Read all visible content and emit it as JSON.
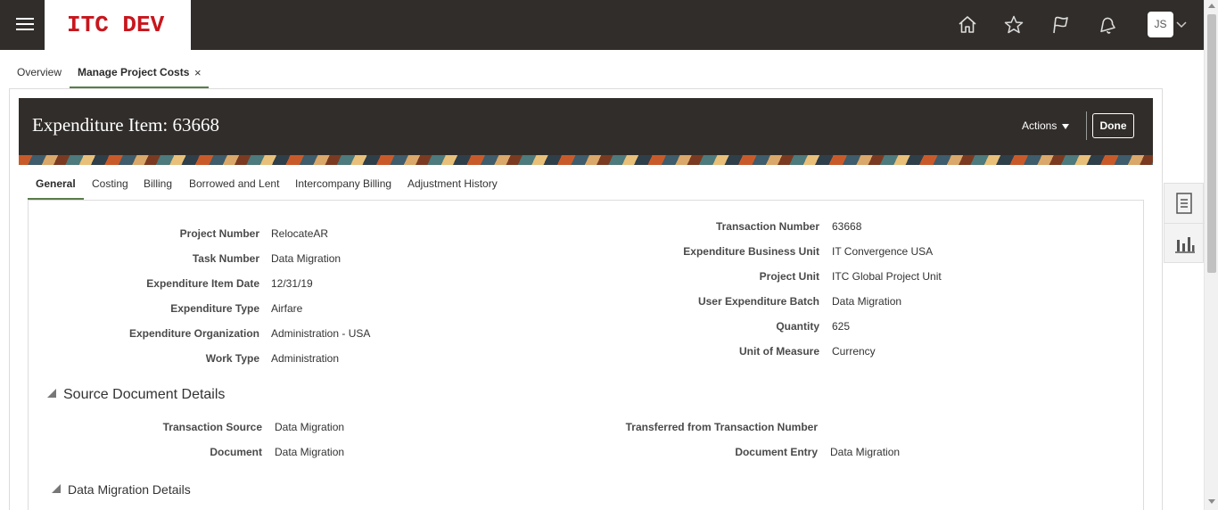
{
  "app": {
    "brand": "ITC DEV",
    "user_initials": "JS"
  },
  "topbar_icons": [
    "home-icon",
    "star-icon",
    "flag-icon",
    "notification-icon"
  ],
  "page_tabs": [
    {
      "label": "Overview"
    },
    {
      "label": "Manage Project Costs"
    }
  ],
  "header": {
    "title": "Expenditure Item: 63668",
    "actions_label": "Actions",
    "done_label": "Done"
  },
  "content_tabs": [
    {
      "label": "General"
    },
    {
      "label": "Costing"
    },
    {
      "label": "Billing"
    },
    {
      "label": "Borrowed and Lent"
    },
    {
      "label": "Intercompany Billing"
    },
    {
      "label": "Adjustment History"
    }
  ],
  "left_fields": [
    {
      "label": "Project Number",
      "value": "RelocateAR"
    },
    {
      "label": "Task Number",
      "value": "Data Migration"
    },
    {
      "label": "Expenditure Item Date",
      "value": "12/31/19"
    },
    {
      "label": "Expenditure Type",
      "value": "Airfare"
    },
    {
      "label": "Expenditure Organization",
      "value": "Administration - USA"
    },
    {
      "label": "Work Type",
      "value": "Administration"
    }
  ],
  "right_fields": [
    {
      "label": "Transaction Number",
      "value": "63668"
    },
    {
      "label": "Expenditure Business Unit",
      "value": "IT Convergence USA"
    },
    {
      "label": "Project Unit",
      "value": "ITC Global Project Unit"
    },
    {
      "label": "User Expenditure Batch",
      "value": "Data Migration"
    },
    {
      "label": "Quantity",
      "value": "625"
    },
    {
      "label": "Unit of Measure",
      "value": "Currency"
    }
  ],
  "source_section": {
    "title": "Source Document Details",
    "left": [
      {
        "label": "Transaction Source",
        "value": "Data Migration"
      },
      {
        "label": "Document",
        "value": "Data Migration"
      }
    ],
    "right": [
      {
        "label": "Transferred from Transaction Number",
        "value": ""
      },
      {
        "label": "Document Entry",
        "value": "Data Migration"
      }
    ]
  },
  "migration_section": {
    "title": "Data Migration Details"
  }
}
